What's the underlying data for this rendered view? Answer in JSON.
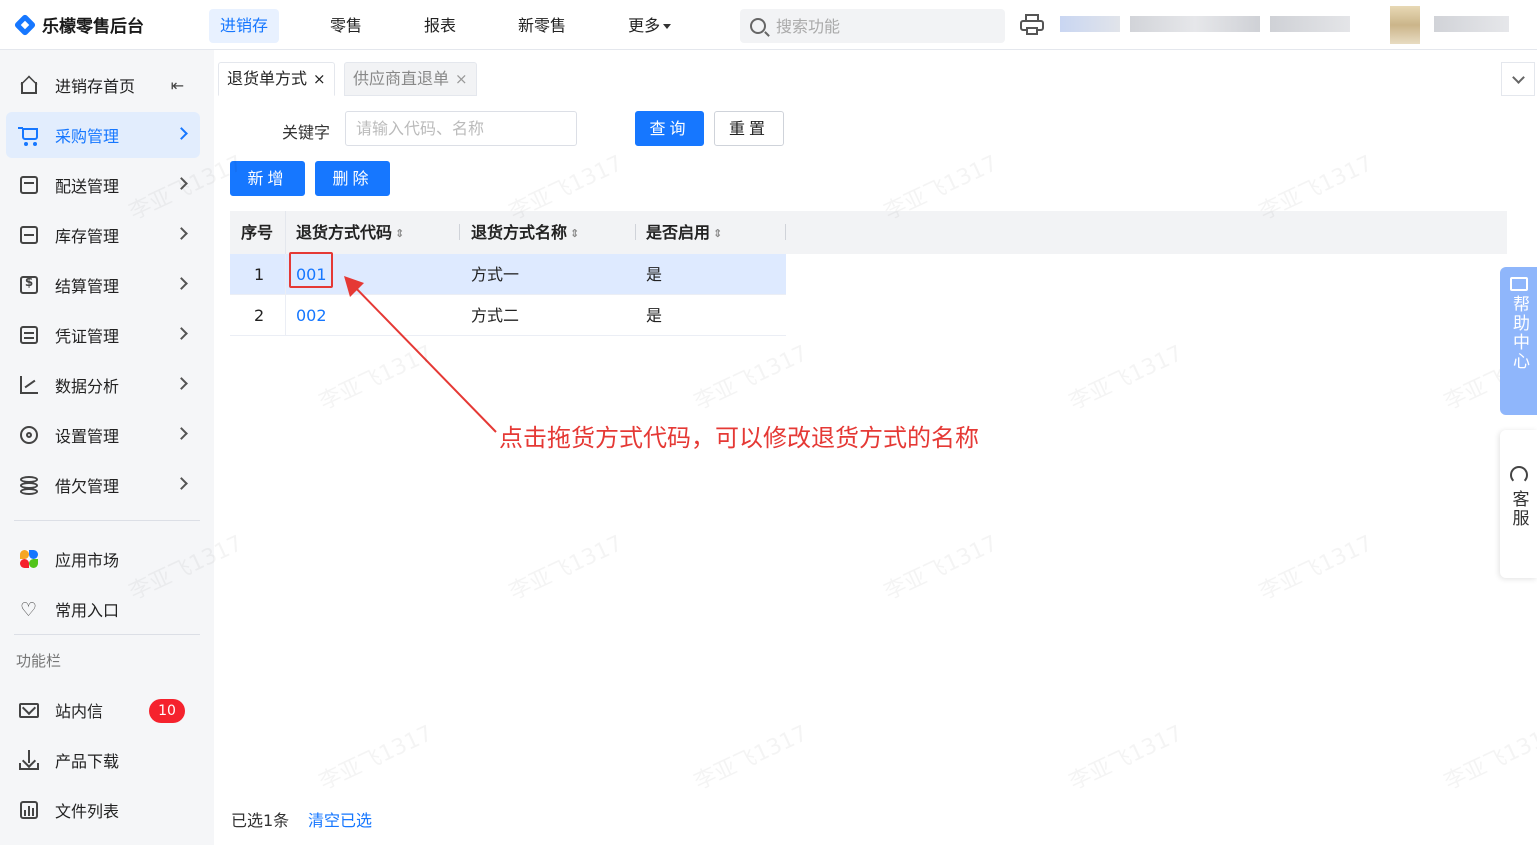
{
  "app": {
    "title": "乐檬零售后台"
  },
  "topnav": [
    {
      "label": "进销存",
      "active": true
    },
    {
      "label": "零售"
    },
    {
      "label": "报表"
    },
    {
      "label": "新零售"
    },
    {
      "label": "更多"
    }
  ],
  "search": {
    "placeholder": "搜索功能"
  },
  "sidebar": {
    "items": [
      {
        "label": "进销存首页",
        "icon": "home-icon"
      },
      {
        "label": "采购管理",
        "icon": "cart-icon",
        "active": true
      },
      {
        "label": "配送管理",
        "icon": "delivery-icon"
      },
      {
        "label": "库存管理",
        "icon": "inventory-icon"
      },
      {
        "label": "结算管理",
        "icon": "settlement-icon"
      },
      {
        "label": "凭证管理",
        "icon": "voucher-icon"
      },
      {
        "label": "数据分析",
        "icon": "analytics-icon"
      },
      {
        "label": "设置管理",
        "icon": "settings-icon"
      },
      {
        "label": "借欠管理",
        "icon": "debt-icon"
      }
    ],
    "extra": [
      {
        "label": "应用市场",
        "icon": "app-market-icon"
      },
      {
        "label": "常用入口",
        "icon": "heart-icon"
      }
    ],
    "section_title": "功能栏",
    "tools": [
      {
        "label": "站内信",
        "icon": "mail-icon",
        "badge": "10"
      },
      {
        "label": "产品下载",
        "icon": "download-icon"
      },
      {
        "label": "文件列表",
        "icon": "file-list-icon"
      }
    ]
  },
  "tabs": [
    {
      "label": "退货单方式",
      "active": true,
      "close": "×"
    },
    {
      "label": "供应商直退单",
      "active": false,
      "close": "×"
    }
  ],
  "filter": {
    "label": "关键字",
    "placeholder": "请输入代码、名称",
    "query_label": "查询",
    "reset_label": "重置"
  },
  "toolbar": {
    "add_label": "新增",
    "delete_label": "删除"
  },
  "table": {
    "columns": [
      "序号",
      "退货方式代码",
      "退货方式名称",
      "是否启用"
    ],
    "rows": [
      {
        "index": "1",
        "code": "001",
        "name": "方式一",
        "enabled": "是",
        "selected": true
      },
      {
        "index": "2",
        "code": "002",
        "name": "方式二",
        "enabled": "是",
        "selected": false
      }
    ]
  },
  "annotation": {
    "text": "点击拖货方式代码，可以修改退货方式的名称",
    "color": "#e53935"
  },
  "footer": {
    "selected_text": "已选1条",
    "clear_label": "清空已选"
  },
  "help": {
    "label": "帮助中心"
  },
  "kefu": {
    "label": "客服"
  },
  "watermark": {
    "text": "李亚飞1317"
  },
  "colors": {
    "accent": "#1677ff",
    "danger": "#f5222d",
    "annotation": "#e53935"
  }
}
